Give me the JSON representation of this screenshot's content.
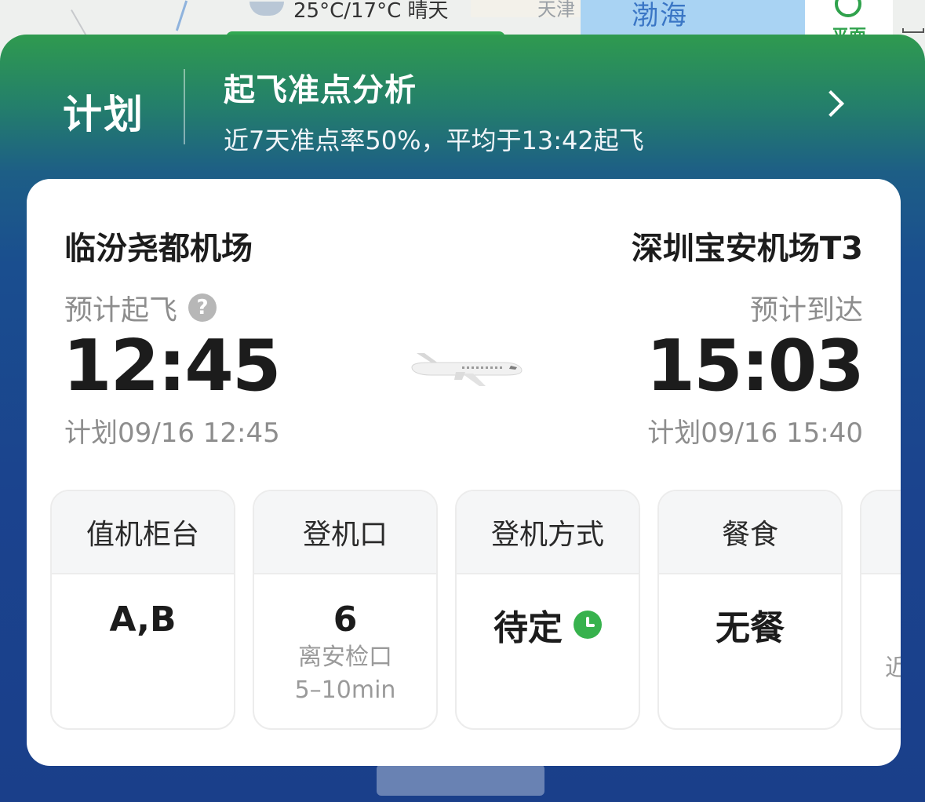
{
  "map": {
    "water_label": "渤海",
    "city_label": "天津",
    "weather_text": "25°C/17°C 晴天",
    "mode_label": "平面"
  },
  "header": {
    "plan_label": "计划",
    "ontime_title": "起飞准点分析",
    "ontime_desc": "近7天准点率50%，平均于13:42起飞"
  },
  "flight": {
    "departure": {
      "airport": "临汾尧都机场",
      "label": "预计起飞",
      "time": "12:45",
      "scheduled": "计划09/16 12:45"
    },
    "arrival": {
      "airport": "深圳宝安机场T3",
      "label": "预计到达",
      "time": "15:03",
      "scheduled": "计划09/16 15:40"
    }
  },
  "tiles": [
    {
      "title": "值机柜台",
      "value": "A,B",
      "sub1": "",
      "sub2": ""
    },
    {
      "title": "登机口",
      "value": "6",
      "sub1": "离安检口",
      "sub2": "5–10min"
    },
    {
      "title": "登机方式",
      "value": "待定",
      "sub1": "",
      "sub2": ""
    },
    {
      "title": "餐食",
      "value": "无餐",
      "sub1": "",
      "sub2": ""
    },
    {
      "title": "",
      "value": "",
      "sub1": "近",
      "sub2": ""
    }
  ],
  "icons": {
    "help": "question-mark-icon",
    "chevron": "chevron-right-icon",
    "clock": "clock-icon",
    "plane": "airplane-icon"
  },
  "colors": {
    "accent_green": "#37b24d",
    "panel_top": "#2f9a4f",
    "panel_bottom": "#1a3f8a"
  }
}
